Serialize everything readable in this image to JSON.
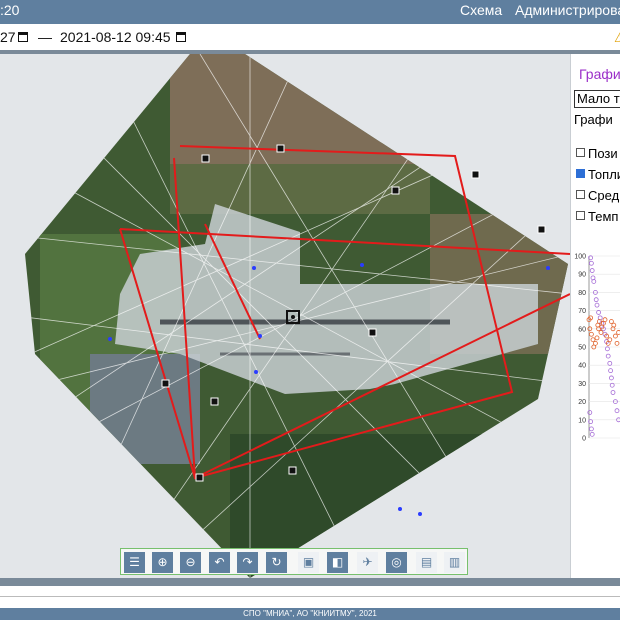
{
  "header": {
    "clock": ":20",
    "nav": [
      {
        "label": "Схема"
      },
      {
        "label": "Администрирова"
      }
    ]
  },
  "date_range": {
    "from": "27",
    "dash": "—",
    "to": "2021-08-12 09:45"
  },
  "icons": {
    "calendar": "calendar-icon",
    "warning": "warning-icon"
  },
  "right_panel": {
    "tab_title": "Графи",
    "select_value": "Мало т",
    "graph_label": "Графи",
    "checkboxes": [
      {
        "label": "Пози",
        "checked": false
      },
      {
        "label": "Топли",
        "checked": true
      },
      {
        "label": "Сред",
        "checked": false
      },
      {
        "label": "Темп",
        "checked": false
      }
    ]
  },
  "chart_data": {
    "type": "scatter",
    "yticks": [
      "0",
      "10",
      "20",
      "30",
      "40",
      "50",
      "60",
      "70",
      "80",
      "90",
      "100"
    ],
    "ylim": [
      0,
      100
    ],
    "series": [
      {
        "color": "#a46bd6",
        "points": [
          [
            2,
            99
          ],
          [
            3,
            96
          ],
          [
            4,
            92
          ],
          [
            5,
            88
          ],
          [
            6,
            86
          ],
          [
            8,
            80
          ],
          [
            9,
            76
          ],
          [
            10,
            73
          ],
          [
            12,
            69
          ],
          [
            14,
            66
          ],
          [
            16,
            63
          ],
          [
            18,
            60
          ],
          [
            20,
            57
          ],
          [
            22,
            53
          ],
          [
            23,
            49
          ],
          [
            24,
            45
          ],
          [
            26,
            41
          ],
          [
            27,
            37
          ],
          [
            28,
            33
          ],
          [
            29,
            29
          ],
          [
            30,
            25
          ],
          [
            1,
            14
          ],
          [
            2,
            9
          ],
          [
            3,
            5
          ],
          [
            4,
            2
          ],
          [
            33,
            20
          ],
          [
            35,
            15
          ],
          [
            37,
            10
          ]
        ]
      },
      {
        "color": "#e0612a",
        "points": [
          [
            0,
            65
          ],
          [
            1,
            60
          ],
          [
            2,
            66
          ],
          [
            3,
            57
          ],
          [
            5,
            54
          ],
          [
            6,
            50
          ],
          [
            8,
            52
          ],
          [
            10,
            55
          ],
          [
            11,
            62
          ],
          [
            12,
            60
          ],
          [
            13,
            64
          ],
          [
            15,
            58
          ],
          [
            16,
            61
          ],
          [
            18,
            63
          ],
          [
            20,
            65
          ],
          [
            22,
            56
          ],
          [
            24,
            52
          ],
          [
            26,
            54
          ],
          [
            28,
            64
          ],
          [
            30,
            60
          ],
          [
            31,
            62
          ],
          [
            33,
            56
          ],
          [
            35,
            52
          ],
          [
            37,
            58
          ]
        ]
      }
    ]
  },
  "toolbar": {
    "buttons": [
      {
        "name": "list-button",
        "icon": "list-icon",
        "glyph": "☰"
      },
      {
        "name": "zoom-in-button",
        "icon": "zoom-in-icon",
        "glyph": "⊕"
      },
      {
        "name": "zoom-out-button",
        "icon": "zoom-out-icon",
        "glyph": "⊖"
      },
      {
        "name": "undo-button",
        "icon": "undo-icon",
        "glyph": "↶"
      },
      {
        "name": "redo-button",
        "icon": "redo-icon",
        "glyph": "↷"
      },
      {
        "name": "refresh-button",
        "icon": "refresh-icon",
        "glyph": "↻"
      },
      {
        "name": "image-button",
        "icon": "image-icon",
        "glyph": "▣"
      },
      {
        "name": "layers-button",
        "icon": "layers-icon",
        "glyph": "◧"
      },
      {
        "name": "plane-button",
        "icon": "plane-icon",
        "glyph": "✈"
      },
      {
        "name": "target-button",
        "icon": "target-icon",
        "glyph": "◎"
      },
      {
        "name": "document-button",
        "icon": "document-icon",
        "glyph": "▤"
      },
      {
        "name": "chart-button",
        "icon": "bar-chart-icon",
        "glyph": "▥"
      }
    ]
  },
  "footer": {
    "text": "СПО \"МНИА\", АО \"КНИИТМУ\", 2021"
  },
  "colors": {
    "header_bg": "#5f7f9f",
    "tab_title": "#9b2fc9",
    "boundary_line": "#e31b1b",
    "track_line": "#ffffff",
    "point": "#2a3cff",
    "toolbar_border": "#77c06d"
  }
}
